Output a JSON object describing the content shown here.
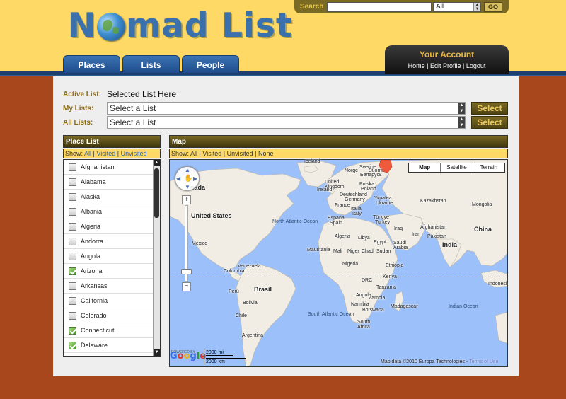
{
  "header": {
    "logo_text_1": "N",
    "logo_text_2": "mad List",
    "search": {
      "label": "Search",
      "value": "",
      "scope": "All",
      "go_label": "GO"
    },
    "tabs": [
      {
        "label": "Places"
      },
      {
        "label": "Lists"
      },
      {
        "label": "People"
      }
    ],
    "account": {
      "title": "Your Account",
      "links": [
        "Home",
        "Edit Profile",
        "Logout"
      ],
      "separator": " | "
    }
  },
  "lists": {
    "active_label": "Active List:",
    "active_value": "Selected List Here",
    "my_label": "My Lists:",
    "my_value": "Select a List",
    "all_label": "All Lists:",
    "all_value": "Select a List",
    "select_button": "Select"
  },
  "place_list": {
    "title": "Place List",
    "filter_prefix": "Show:",
    "filters": [
      "All",
      "Visited",
      "Unvisited"
    ],
    "items": [
      {
        "name": "Afghanistan",
        "checked": false
      },
      {
        "name": "Alabama",
        "checked": false
      },
      {
        "name": "Alaska",
        "checked": false
      },
      {
        "name": "Albania",
        "checked": false
      },
      {
        "name": "Algeria",
        "checked": false
      },
      {
        "name": "Andorra",
        "checked": false
      },
      {
        "name": "Angola",
        "checked": false
      },
      {
        "name": "Arizona",
        "checked": true
      },
      {
        "name": "Arkansas",
        "checked": false
      },
      {
        "name": "California",
        "checked": false
      },
      {
        "name": "Colorado",
        "checked": false
      },
      {
        "name": "Connecticut",
        "checked": true
      },
      {
        "name": "Delaware",
        "checked": true
      }
    ]
  },
  "map": {
    "title": "Map",
    "filter_prefix": "Show:",
    "filters": [
      "All",
      "Visited",
      "Unvisited",
      "None"
    ],
    "types": [
      "Map",
      "Satellite",
      "Terrain"
    ],
    "powered_by": "POWERED BY",
    "google": "Google",
    "scale_mi": "2000 mi",
    "scale_km": "2000 km",
    "attribution": "Map data ©2010 Europa Technologies - ",
    "terms": "Terms of Use",
    "labels": {
      "iceland": "Iceland",
      "canada": "nada",
      "united_states": "United States",
      "mexico": "México",
      "venezuela": "Venezuela",
      "colombia": "Colombia",
      "peru": "Perú",
      "brasil": "Brasil",
      "bolivia": "Bolivia",
      "chile": "Chile",
      "argentina": "Argentina",
      "north_atlantic": "North Atlantic Ocean",
      "south_atlantic": "South Atlantic Ocean",
      "indian_ocean": "Indian Ocean",
      "sweden": "Sverige",
      "norway": "Norge",
      "finland": "Suomi",
      "uk": "United Kingdom",
      "ireland": "Ireland",
      "deutschland": "Deutschland",
      "germany": "Germany",
      "polska": "Polska",
      "poland": "Poland",
      "belarus": "Беларусь",
      "ukraine": "Україна",
      "ukraine_en": "Ukraine",
      "france": "France",
      "espana": "España",
      "spain": "Spain",
      "italia": "Italia",
      "italy": "Italy",
      "turkiye": "Türkiye",
      "turkey": "Turkey",
      "kazakhstan": "Kazakhstan",
      "mongolia": "Mongolia",
      "china": "China",
      "afghanistan": "Afghanistan",
      "pakistan": "Pakistan",
      "iraq": "Iraq",
      "iran": "Iran",
      "india": "India",
      "saudi_arabia": "Saudi Arabia",
      "egypt": "Egypt",
      "libya": "Libya",
      "algeria": "Algeria",
      "mali": "Mali",
      "niger": "Niger",
      "chad": "Chad",
      "sudan": "Sudan",
      "mauritania": "Mauritania",
      "nigeria": "Nigeria",
      "ethiopia": "Ethiopia",
      "kenya": "Kenya",
      "drc": "DRC",
      "tanzania": "Tanzania",
      "angola": "Angola",
      "zambia": "Zambia",
      "namibia": "Namibia",
      "botswana": "Botswana",
      "south_africa": "South Africa",
      "madagascar": "Madagascar",
      "indonesia": "Indonesi"
    }
  }
}
